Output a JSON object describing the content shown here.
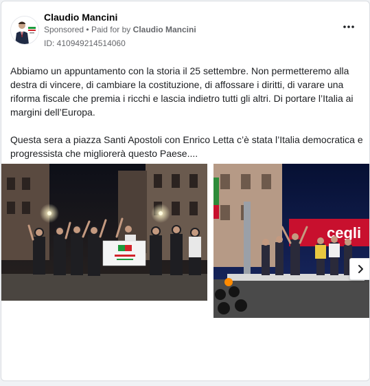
{
  "post": {
    "author": "Claudio Mancini",
    "sponsored_label": "Sponsored",
    "paid_for_prefix": "Paid for by",
    "paid_for_name": "Claudio Mancini",
    "ad_id": "ID: 410949214514060",
    "paragraphs": [
      "Abbiamo un appuntamento con la storia il 25 settembre. Non permetteremo alla destra di vincere, di cambiare la costituzione, di affossare i diritti, di varare una riforma fiscale che premia i ricchi e lascia indietro tutti gli altri. Di portare l’Italia ai margini dell’Europa.",
      "Questa sera a piazza Santi Apostoli con Enrico Letta c’è stata l’Italia democratica e progressista che migliorerà questo Paese...."
    ]
  },
  "icons": {
    "more": "more-options-icon",
    "next": "chevron-right-icon"
  },
  "colors": {
    "muted_text": "#65676b",
    "border": "#dadde1",
    "pd_red": "#d2232a",
    "pd_green": "#1d9a3c",
    "stage_red": "#c8102e",
    "night_blue": "#0a1a4a"
  }
}
